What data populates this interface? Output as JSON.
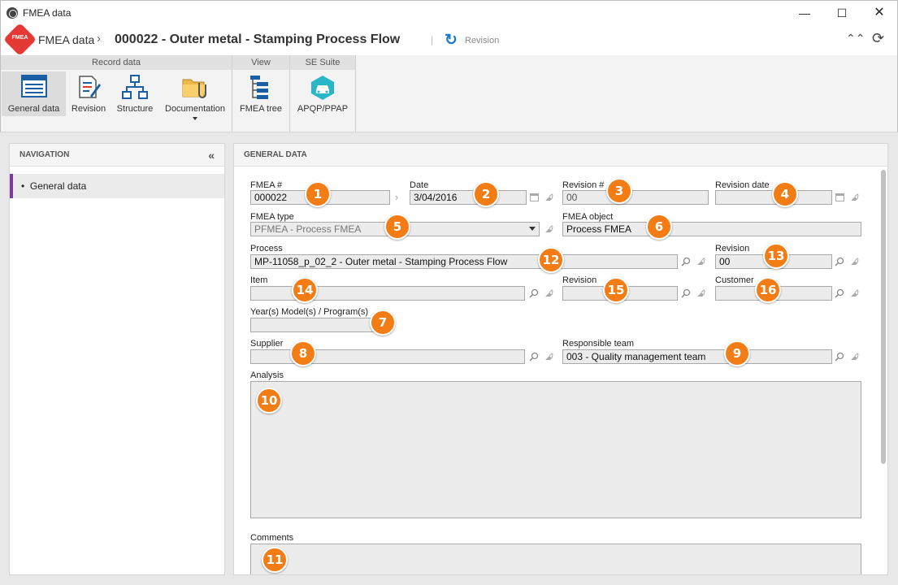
{
  "window": {
    "title": "FMEA data"
  },
  "header": {
    "logo_text": "FMEA",
    "module": "FMEA data",
    "record": "000022 - Outer metal - Stamping Process Flow",
    "revision_label": "Revision"
  },
  "ribbon": {
    "groups": [
      "Record data",
      "View",
      "SE Suite"
    ],
    "buttons": {
      "general_data": "General data",
      "revision": "Revision",
      "structure": "Structure",
      "documentation": "Documentation",
      "fmea_tree": "FMEA tree",
      "apqp": "APQP/PPAP"
    }
  },
  "nav": {
    "heading": "NAVIGATION",
    "items": [
      "General data"
    ]
  },
  "main": {
    "heading": "GENERAL DATA",
    "labels": {
      "fmea_no": "FMEA #",
      "date": "Date",
      "revision_no": "Revision #",
      "revision_date": "Revision date",
      "fmea_type": "FMEA type",
      "fmea_object": "FMEA object",
      "process": "Process",
      "process_revision": "Revision",
      "item": "Item",
      "item_revision": "Revision",
      "customer": "Customer",
      "years_models": "Year(s) Model(s) / Program(s)",
      "supplier": "Supplier",
      "responsible_team": "Responsible team",
      "analysis": "Analysis",
      "comments": "Comments"
    },
    "values": {
      "fmea_no": "000022",
      "date": "3/04/2016",
      "revision_no": "00",
      "revision_date": "",
      "fmea_type": "PFMEA - Process FMEA",
      "fmea_object": "Process FMEA",
      "process": "MP-11058_p_02_2 - Outer metal - Stamping Process Flow",
      "process_revision": "00",
      "item": "",
      "item_revision": "",
      "customer": "",
      "years_models": "",
      "supplier": "",
      "responsible_team": "003 - Quality management team",
      "analysis": "",
      "comments": ""
    }
  },
  "callouts": [
    "1",
    "2",
    "3",
    "4",
    "5",
    "6",
    "7",
    "8",
    "9",
    "10",
    "11",
    "12",
    "13",
    "14",
    "15",
    "16"
  ],
  "colors": {
    "accent": "#7c3d9a",
    "callout": "#f47c14",
    "brand": "#e53935",
    "revision_icon": "#1e7ac8"
  }
}
